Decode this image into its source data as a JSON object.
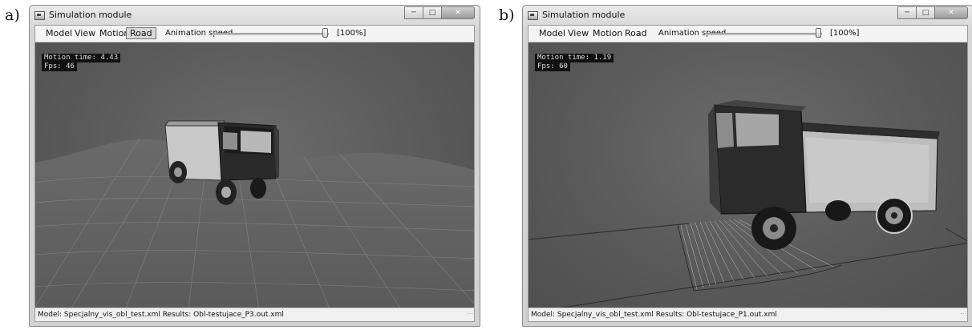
{
  "panels": [
    {
      "label": "a)",
      "window": {
        "title": "Simulation module",
        "menu": [
          "Model",
          "View",
          "Motion",
          "Road"
        ],
        "active_menu": "Road",
        "speed_label": "Animation speed",
        "speed_value": "[100%]",
        "speed_fraction": 1.0,
        "hud": {
          "motion_time": "Motion time: 4.43",
          "fps": "Fps: 46"
        },
        "status": "Model: Specjalny_vis_obl_test.xml  Results: Obl-testujace_P3.out.xml"
      }
    },
    {
      "label": "b)",
      "window": {
        "title": "Simulation module",
        "menu": [
          "Model",
          "View",
          "Motion",
          "Road"
        ],
        "active_menu": "",
        "speed_label": "Animation speed",
        "speed_value": "[100%]",
        "speed_fraction": 1.0,
        "hud": {
          "motion_time": "Motion time: 1.19",
          "fps": "Fps: 60"
        },
        "status": "Model: Specjalny_vis_obl_test.xml  Results: Obl-testujace_P1.out.xml"
      }
    }
  ],
  "caption_buttons": [
    "minimize",
    "maximize",
    "close"
  ],
  "colors": {
    "viewport_bg": "#5b5b5b",
    "hud_bg": "#111111",
    "titlebar": "#e0e0e0"
  }
}
